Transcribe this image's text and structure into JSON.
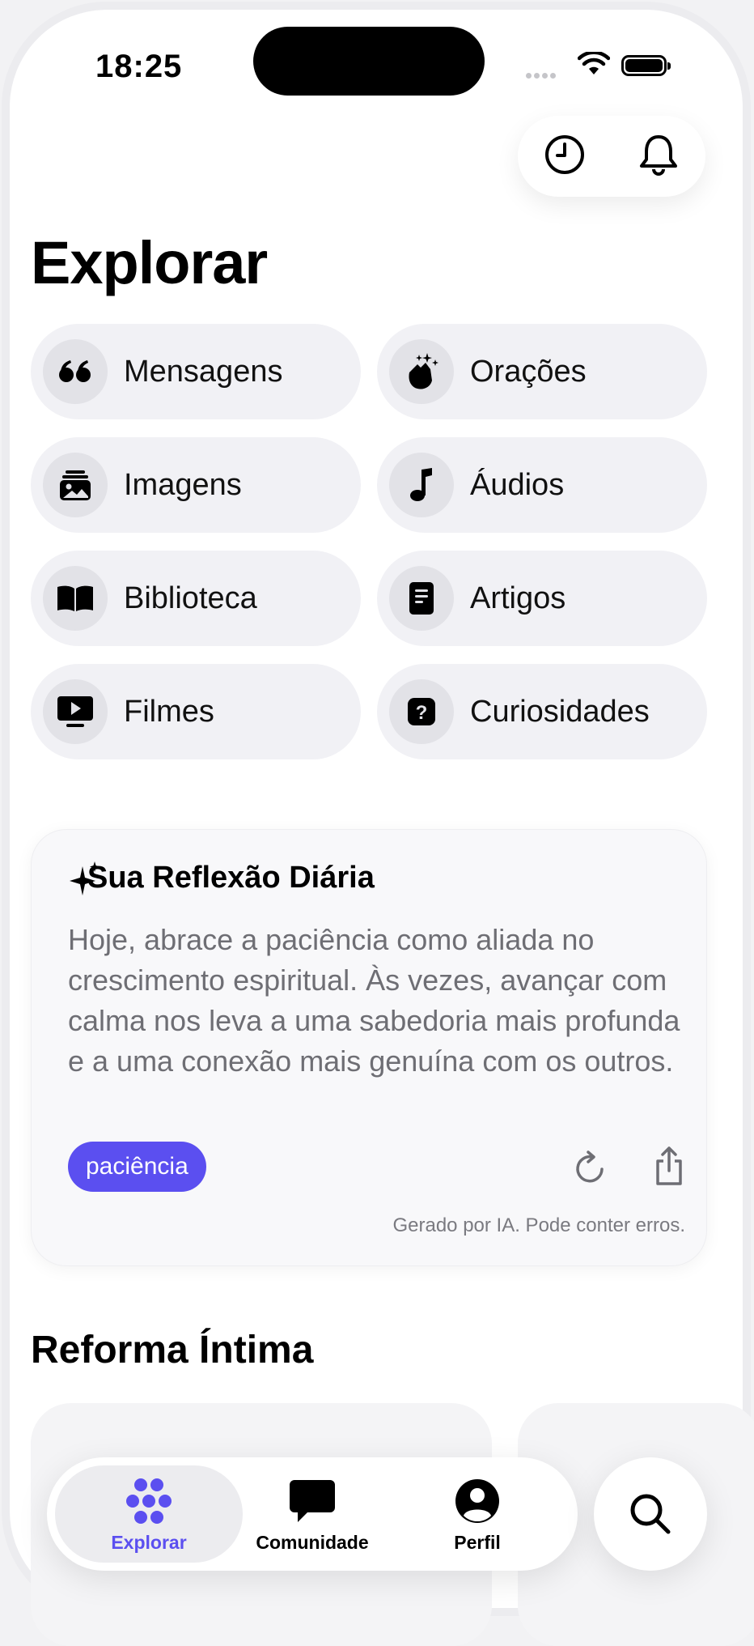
{
  "status": {
    "time": "18:25"
  },
  "page": {
    "title": "Explorar"
  },
  "categories": [
    {
      "label": "Mensagens",
      "icon": "quote-icon"
    },
    {
      "label": "Orações",
      "icon": "praying-hands-icon"
    },
    {
      "label": "Imagens",
      "icon": "images-icon"
    },
    {
      "label": "Áudios",
      "icon": "music-note-icon"
    },
    {
      "label": "Biblioteca",
      "icon": "book-icon"
    },
    {
      "label": "Artigos",
      "icon": "document-icon"
    },
    {
      "label": "Filmes",
      "icon": "tv-play-icon"
    },
    {
      "label": "Curiosidades",
      "icon": "question-icon"
    }
  ],
  "reflection": {
    "title": "Sua Reflexão Diária",
    "text": "Hoje, abrace a paciência como aliada no crescimento espiritual. Às vezes, avançar com calma nos leva a uma sabedoria mais profunda e a uma conexão mais genuína com os outros.",
    "tag": "paciência",
    "disclaimer": "Gerado por IA. Pode conter erros."
  },
  "section": {
    "title": "Reforma Íntima"
  },
  "tabs": [
    {
      "label": "Explorar",
      "icon": "explore-icon",
      "active": true
    },
    {
      "label": "Comunidade",
      "icon": "chat-bubble-icon",
      "active": false
    },
    {
      "label": "Perfil",
      "icon": "person-icon",
      "active": false
    }
  ],
  "colors": {
    "accent": "#5b4ff0",
    "tab_active_bg": "#ececef",
    "pill_bg": "#f1f1f5"
  }
}
